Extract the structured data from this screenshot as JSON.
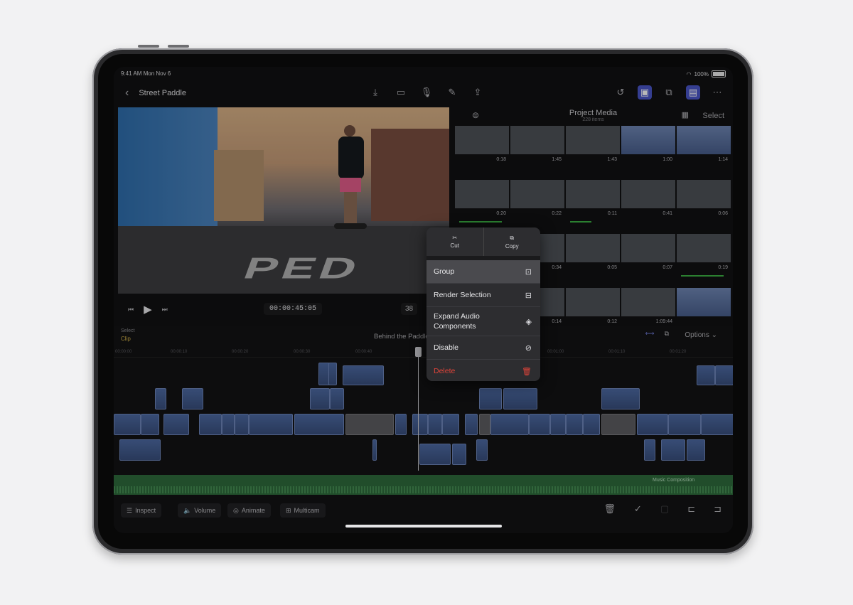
{
  "status_bar": {
    "time": "9:41 AM  Mon Nov 6",
    "battery": "100%"
  },
  "toolbar": {
    "back_icon": "chevron-left-icon",
    "project_title": "Street Paddle",
    "center_icons": [
      "import-icon",
      "camera-icon",
      "microphone-icon",
      "pen-icon",
      "share-icon"
    ],
    "right_icons": [
      "undo-icon",
      "photo-browser-icon",
      "add-clip-icon",
      "inspector-icon",
      "more-icon"
    ]
  },
  "viewer": {
    "timecode": "00:00:45:05",
    "zoom": "38",
    "overlay_text": "PED"
  },
  "browser": {
    "title": "Project Media",
    "subtitle": "228 items",
    "select_label": "Select",
    "rows": [
      [
        "0:18",
        "1:45",
        "1:43",
        "1:00",
        "1:14"
      ],
      [
        "0:20",
        "0:22",
        "0:11",
        "0:41",
        "0:06"
      ],
      [
        "0:34",
        "0:05",
        "0:07",
        "0:19"
      ],
      [
        "0:14",
        "0:12",
        "1:09:44",
        ""
      ]
    ]
  },
  "context_menu": {
    "cut_label": "Cut",
    "copy_label": "Copy",
    "items": [
      {
        "label": "Group",
        "icon": "group-icon"
      },
      {
        "label": "Render Selection",
        "icon": "render-icon"
      },
      {
        "label": "Expand Audio Components",
        "icon": "audio-components-icon"
      },
      {
        "label": "Disable",
        "icon": "disable-icon"
      },
      {
        "label": "Delete",
        "icon": "trash-icon"
      }
    ]
  },
  "timeline": {
    "tag": "Select",
    "clip_label": "Clip",
    "project_name": "Behind the Paddle",
    "options_label": "Options",
    "ruler": [
      "00:00:00",
      "00:00:10",
      "00:00:20",
      "00:00:30",
      "00:00:40",
      "00:00:50",
      "00:01:00",
      "00:01:10",
      "00:01:20",
      "00:01:30"
    ],
    "music_label": "Music Composition"
  },
  "bottom_bar": {
    "inspect_label": "Inspect",
    "volume_label": "Volume",
    "animate_label": "Animate",
    "multicam_label": "Multicam"
  },
  "colors": {
    "accent": "#4a57c9",
    "clip_blue": "#4d6aa3",
    "music_green": "#2f6b3c",
    "delete_red": "#e0443a"
  }
}
